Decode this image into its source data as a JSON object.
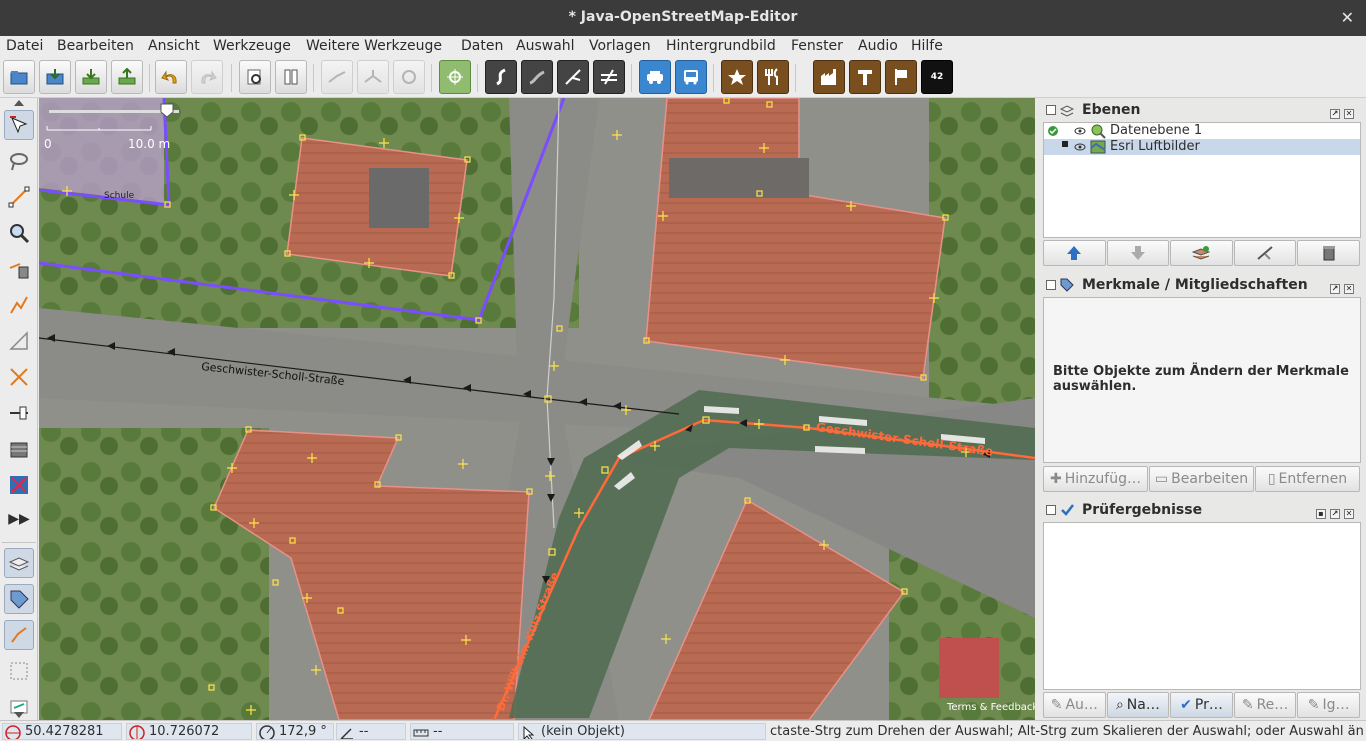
{
  "window": {
    "title": "* Java-OpenStreetMap-Editor",
    "close_glyph": "✕"
  },
  "menu": [
    "Datei",
    "Bearbeiten",
    "Ansicht",
    "Werkzeuge",
    "Weitere Werkzeuge",
    "Daten",
    "Auswahl",
    "Vorlagen",
    "Hintergrundbild",
    "Fenster",
    "Audio",
    "Hilfe"
  ],
  "toolbar": {
    "preset_badge": "42",
    "icons": [
      "open-icon",
      "download-icon",
      "download-data-icon",
      "upload-icon",
      "undo-icon",
      "redo-icon",
      "preferences-icon",
      "map-paint-icon",
      "split-way-icon",
      "combine-way-icon",
      "reverse-icon",
      "select-all-icon",
      "highway-icon",
      "track-icon",
      "link-icon",
      "barrier-icon",
      "car-icon",
      "bus-icon",
      "star-icon",
      "restaurant-icon",
      "industrial-icon",
      "tool-icon",
      "sign-icon",
      "preset-42-icon"
    ]
  },
  "map": {
    "scale_zero": "0",
    "scale_value": "10.0 m",
    "label_schule": "Schule",
    "street_1": "Geschwister-Scholl-Straße",
    "street_1b": "Geschwister-Scholl-Straße",
    "street_2": "Dr.-Wilhelm-Külz-Straße",
    "attribution": "Terms & Feedback",
    "colors": {
      "building": "#e8918a",
      "way": "#ff6a3a",
      "boundary": "#7a4dff",
      "oneway": "#1a1a1a"
    }
  },
  "layers_panel": {
    "title": "Ebenen",
    "layers": [
      {
        "name": "Datenebene 1",
        "active": true,
        "selected": false
      },
      {
        "name": "Esri Luftbilder",
        "active": false,
        "selected": true
      }
    ],
    "buttons": [
      "move-up-icon",
      "move-down-icon",
      "merge-icon",
      "delete-icon-a",
      "delete-icon-b"
    ]
  },
  "tags_panel": {
    "title": "Merkmale / Mitgliedschaften",
    "message": "Bitte Objekte zum Ändern der Merkmale auswählen.",
    "buttons": [
      "Hinzufüg…",
      "Bearbeiten",
      "Entfernen"
    ]
  },
  "validation_panel": {
    "title": "Prüfergebnisse",
    "tabs": [
      "Au…",
      "Na…",
      "Pr…",
      "Re…",
      "Ig…"
    ]
  },
  "status": {
    "lat": "50.4278281",
    "lon": "10.726072",
    "heading": "172,9 °",
    "angle": "--",
    "distance": "--",
    "object": "(kein Objekt)",
    "help": "ctaste-Strg zum Drehen der Auswahl; Alt-Strg zum Skalieren der Auswahl; oder Auswahl ändern"
  }
}
